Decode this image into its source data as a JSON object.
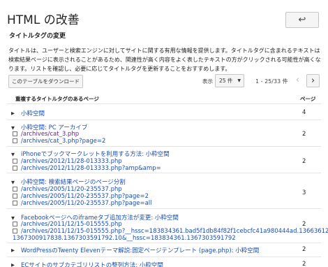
{
  "header": {
    "title": "HTML の改善",
    "back_button": "↩"
  },
  "section": {
    "title": "タイトルタグの変更",
    "description": "タイトルは、ユーザーと検索エンジンに対してサイトに関する有用な情報を提供します。タイトルタグに含まれるテキストは検索結果ページに表示されることがあるため、関連性が高く内容をよく表したテキストの方がクリックされる可能性が高くなります。リストを確認し、必要に応じてタイトルタグを更新することをおすすめします。"
  },
  "toolbar": {
    "download_label": "このテーブルをダウンロード",
    "display_label": "表示",
    "per_page": "25 件",
    "range": "1 - 25/33 件",
    "prev": "‹",
    "next": "›"
  },
  "table": {
    "col_title": "重複するタイトルタグのあるページ",
    "col_pages": "ページ",
    "rows": [
      {
        "title": "小粋空間",
        "count": "4",
        "expanded": false,
        "urls": []
      },
      {
        "title": "小粋空間: PC アーカイブ",
        "count": "2",
        "expanded": true,
        "urls": [
          "/archives/cat_3.php",
          "/archives/cat_3.php?page=2"
        ]
      },
      {
        "title": "iPhoneでブックマークレットを利用する方法: 小粋空間",
        "count": "2",
        "expanded": true,
        "urls": [
          "/archives/2012/11/28-013333.php",
          "/archives/2012/11/28-013333.php?amp&amp="
        ]
      },
      {
        "title": "小粋空間: 検索結果ページのページ分割",
        "count": "3",
        "expanded": true,
        "urls": [
          "/archives/2005/11/20-235537.php",
          "/archives/2005/11/20-235537.php?page=2",
          "/archives/2005/11/20-235537.php?page=all"
        ]
      },
      {
        "title": "Facebookページへのiframeタブ追加方法が変更: 小粋空間",
        "count": "2",
        "expanded": true,
        "urls": [
          "/archives/2011/12/15-015555.php",
          "/archives/2011/12/15-015555.php?__hssc=183834361.bad5f1db84f82f1cebcfc41a980444ad.1366361262866.",
          "1367300917838.1367303591792.10&__hssc=183834361.1367303591792"
        ]
      },
      {
        "title": "WordPressのTwenty Elevenテーマ解説:固定ページテンプレート (page.php): 小粋空間",
        "count": "2",
        "expanded": false,
        "urls": []
      },
      {
        "title": "ECサイトのサブカテゴリリストの整列方法: 小粋空間",
        "count": "2",
        "expanded": false,
        "urls": []
      }
    ]
  }
}
